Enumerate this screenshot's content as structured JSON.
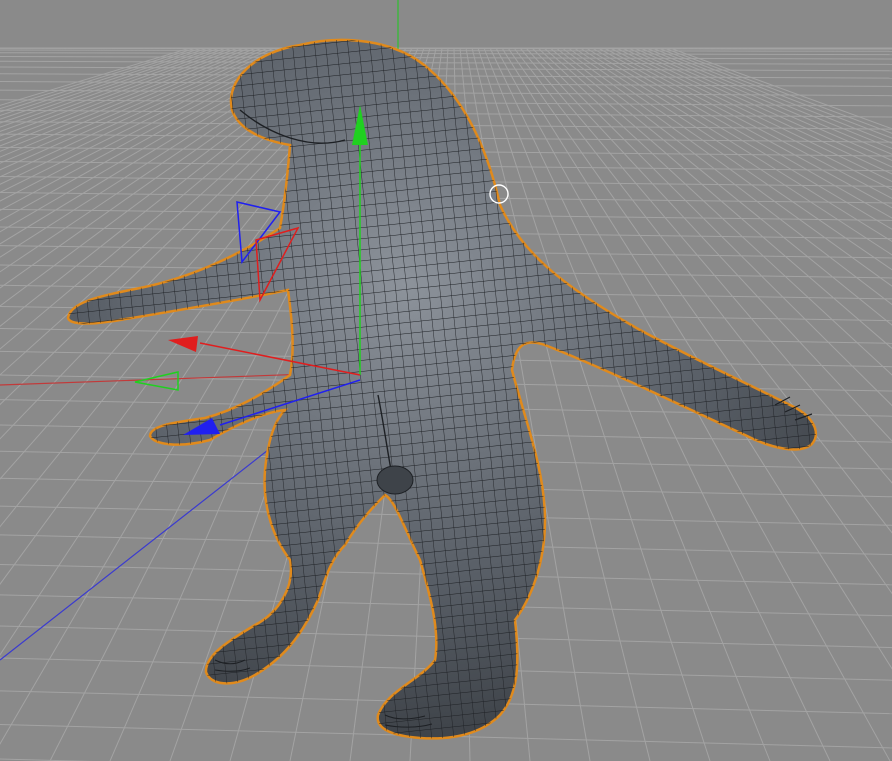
{
  "viewport": {
    "background_color": "#8a8a8a",
    "grid_color": "#a3a3a3",
    "world_axis_x_color": "#c23a3a",
    "world_axis_y_color": "#2fbf2f",
    "world_axis_z_color": "#3a3ad0"
  },
  "mesh": {
    "fill_color": "#4a4f55",
    "wire_color": "#1d2024",
    "selection_outline_color": "#e08a1c"
  },
  "gizmo": {
    "x_axis_color": "#e01e1e",
    "y_axis_color": "#20d020",
    "z_axis_color": "#2020f0",
    "handles": [
      "x-axis-arrow",
      "y-axis-arrow",
      "z-axis-arrow",
      "xy-plane-handle",
      "xz-plane-handle",
      "yz-plane-handle"
    ]
  },
  "cursor": {
    "icon": "circle-cursor-icon"
  }
}
